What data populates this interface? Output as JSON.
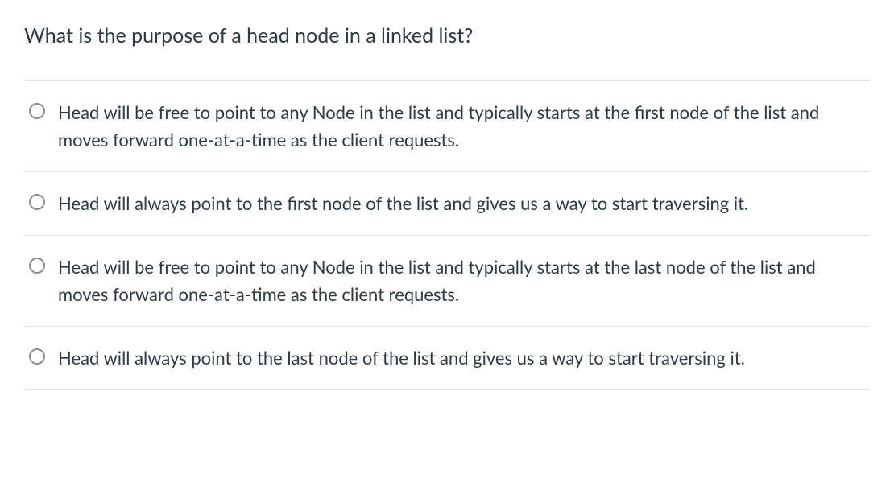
{
  "question": "What is the purpose of a head node in a linked list?",
  "options": [
    {
      "text": "Head will be free to point to any Node in the list and typically starts at the first node of the list and moves forward one-at-a-time as the client requests."
    },
    {
      "text": "Head will always point to the first node of the list and gives us a way to start traversing it."
    },
    {
      "text": "Head will be free to point to any Node in the list and typically starts at the last node of the list and moves forward one-at-a-time as the client requests."
    },
    {
      "text": "Head will always point to the last node of the list and gives us a way to start traversing it."
    }
  ]
}
